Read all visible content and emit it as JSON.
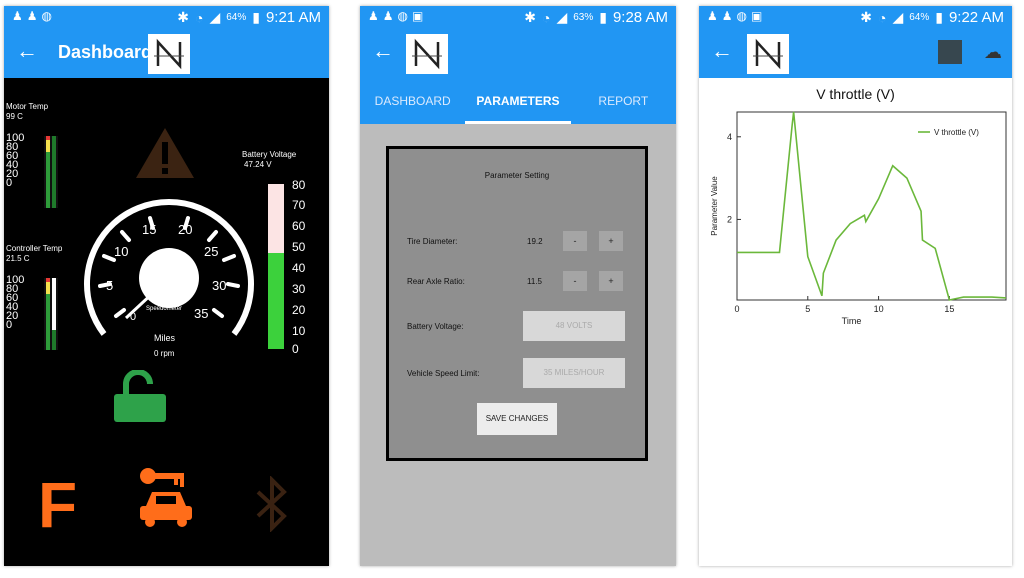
{
  "status_bars": [
    {
      "battery": "64%",
      "time": "9:21 AM"
    },
    {
      "battery": "63%",
      "time": "9:28 AM"
    },
    {
      "battery": "64%",
      "time": "9:22 AM"
    }
  ],
  "dashboard": {
    "title": "Dashboard",
    "motor_temp_label": "Motor Temp",
    "motor_temp_value": "99 C",
    "controller_temp_label": "Controller Temp",
    "controller_temp_value": "21.5 C",
    "battery_voltage_label": "Battery Voltage",
    "battery_voltage_value": "47.24 V",
    "battery_level": 0.58,
    "temp_ticks": [
      "100",
      "80",
      "60",
      "40",
      "20",
      "0"
    ],
    "battery_ticks": [
      "80",
      "70",
      "60",
      "50",
      "40",
      "30",
      "20",
      "10",
      "0"
    ],
    "speedometer_ticks": [
      "0",
      "5",
      "10",
      "15",
      "20",
      "25",
      "30",
      "35"
    ],
    "speedometer_label": "Speedometer",
    "miles_label": "Miles",
    "rpm_value": "0 rpm",
    "f_indicator": "F"
  },
  "parameters": {
    "tabs": [
      "DASHBOARD",
      "PARAMETERS",
      "REPORT"
    ],
    "panel_title": "Parameter Setting",
    "tire_diameter_label": "Tire Diameter:",
    "tire_diameter_value": "19.2",
    "rear_axle_label": "Rear Axle Ratio:",
    "rear_axle_value": "11.5",
    "battery_voltage_label": "Battery Voltage:",
    "battery_voltage_placeholder": "48 VOLTS",
    "speed_limit_label": "Vehicle Speed Limit:",
    "speed_limit_placeholder": "35 MILES/HOUR",
    "minus": "-",
    "plus": "+",
    "save_label": "SAVE CHANGES"
  },
  "report": {
    "title": "V throttle (V)"
  },
  "chart_data": {
    "type": "line",
    "title": "V throttle (V)",
    "xlabel": "Time",
    "ylabel": "Parameter Value",
    "xlim": [
      0,
      19
    ],
    "ylim": [
      0.05,
      4.6
    ],
    "xticks": [
      0,
      5,
      10,
      15
    ],
    "yticks": [
      2,
      4
    ],
    "legend_position": "top-right",
    "series": [
      {
        "name": "V throttle (V)",
        "color": "#6bb83b",
        "x": [
          0,
          3,
          3.9,
          4,
          5,
          6,
          6.1,
          7,
          8,
          9,
          9.1,
          10,
          11,
          12,
          13,
          13.1,
          14,
          15,
          16,
          17,
          18,
          19
        ],
        "y": [
          1.2,
          1.2,
          4.3,
          4.6,
          1.1,
          0.15,
          0.7,
          1.5,
          1.9,
          2.1,
          1.95,
          2.5,
          3.3,
          3.0,
          2.2,
          1.5,
          1.3,
          0.05,
          0.12,
          0.12,
          0.12,
          0.1
        ]
      }
    ]
  }
}
